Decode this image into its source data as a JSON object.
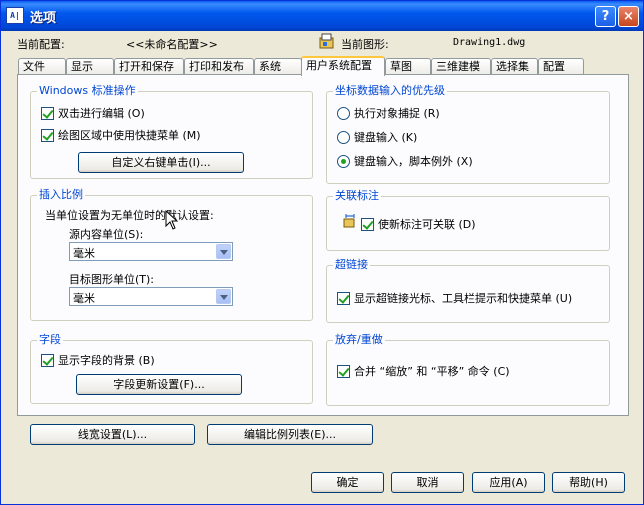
{
  "window": {
    "title": "选项",
    "icon_text": "A|",
    "help_glyph": "?",
    "close_glyph": "×"
  },
  "header": {
    "current_profile_label": "当前配置:",
    "current_profile_value": "<<未命名配置>>",
    "current_drawing_label": "当前图形:",
    "current_drawing_value": "Drawing1.dwg"
  },
  "tabs": [
    {
      "label": "文件"
    },
    {
      "label": "显示"
    },
    {
      "label": "打开和保存"
    },
    {
      "label": "打印和发布"
    },
    {
      "label": "系统"
    },
    {
      "label": "用户系统配置"
    },
    {
      "label": "草图"
    },
    {
      "label": "三维建模"
    },
    {
      "label": "选择集"
    },
    {
      "label": "配置"
    }
  ],
  "active_tab": "用户系统配置",
  "windows_group": {
    "title": "Windows 标准操作",
    "double_click_edit": {
      "label": "双击进行编辑 (O)",
      "checked": true
    },
    "shortcut_menu": {
      "label": "绘图区域中使用快捷菜单 (M)",
      "checked": true
    },
    "right_click_button": "自定义右键单击(I)..."
  },
  "insert_scale_group": {
    "title": "插入比例",
    "description": "当单位设置为无单位时的默认设置:",
    "source_label": "源内容单位(S):",
    "source_value": "毫米",
    "target_label": "目标图形单位(T):",
    "target_value": "毫米"
  },
  "field_group": {
    "title": "字段",
    "show_background": {
      "label": "显示字段的背景 (B)",
      "checked": true
    },
    "update_button": "字段更新设置(F)..."
  },
  "coord_group": {
    "title": "坐标数据输入的优先级",
    "options": [
      {
        "label": "执行对象捕捉 (R)",
        "selected": false
      },
      {
        "label": "键盘输入 (K)",
        "selected": false
      },
      {
        "label": "键盘输入，脚本例外 (X)",
        "selected": true
      }
    ]
  },
  "assoc_group": {
    "title": "关联标注",
    "new_assoc": {
      "label": "使新标注可关联 (D)",
      "checked": true
    }
  },
  "hyperlink_group": {
    "title": "超链接",
    "show_cursor": {
      "label": "显示超链接光标、工具栏提示和快捷菜单 (U)",
      "checked": true
    }
  },
  "undo_group": {
    "title": "放弃/重做",
    "combine": {
      "label": "合并 “缩放” 和 “平移” 命令 (C)",
      "checked": true
    }
  },
  "bottom_buttons": {
    "lineweight": "线宽设置(L)...",
    "scale_list": "编辑比例列表(E)..."
  },
  "dialog_buttons": {
    "ok": "确定",
    "cancel": "取消",
    "apply": "应用(A)",
    "help": "帮助(H)"
  },
  "colors": {
    "title_bar": "#0058EE",
    "group_title": "#0046D5",
    "dialog_bg": "#ECE9D8",
    "panel_bg": "#FCFCFE",
    "check_mark": "#21A121"
  },
  "icons": [
    "drawing-icon",
    "dimension-icon",
    "help-icon",
    "close-icon",
    "dropdown-arrow-icon"
  ]
}
